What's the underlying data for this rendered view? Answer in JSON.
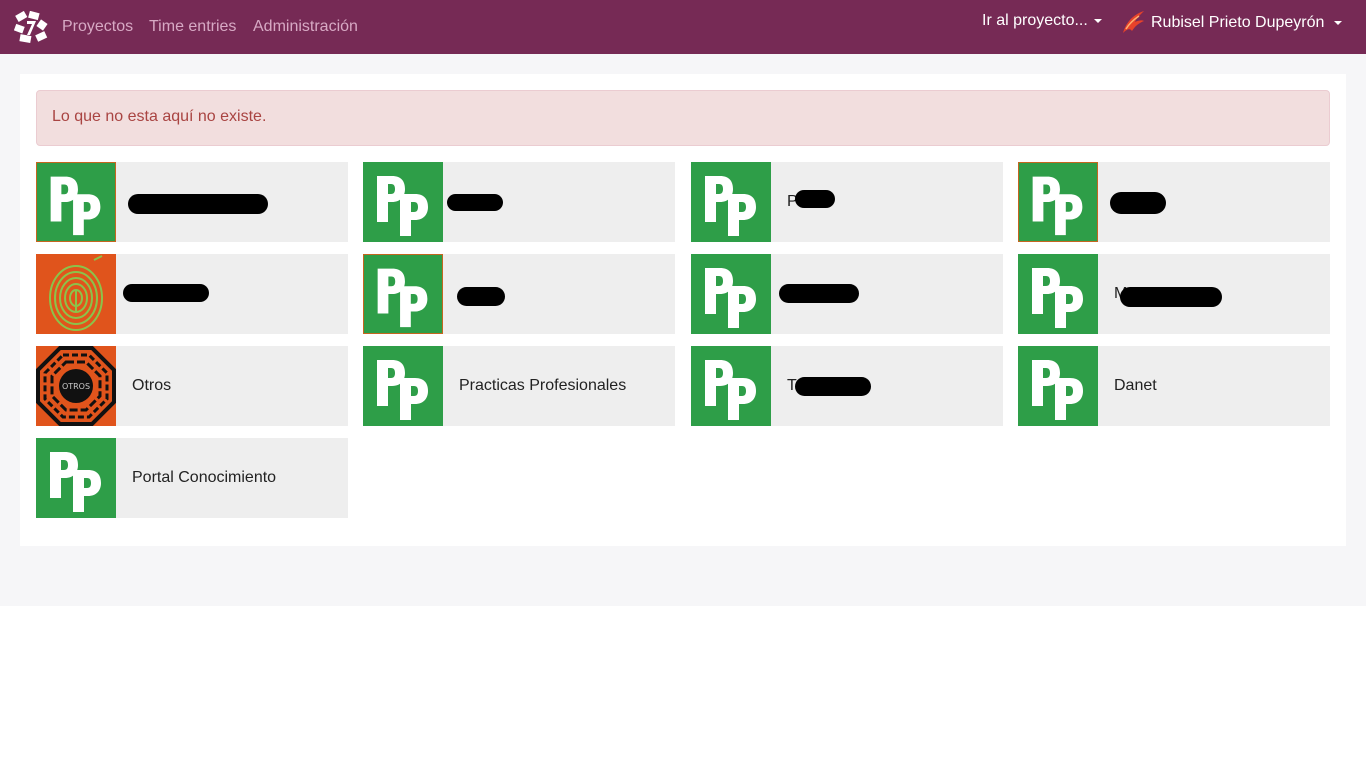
{
  "navbar": {
    "links": [
      "Proyectos",
      "Time entries",
      "Administración"
    ],
    "goto_project": "Ir al proyecto...",
    "user_name": "Rubisel Prieto Dupeyrón",
    "background_color": "#762a55"
  },
  "alert": {
    "message": "Lo que no esta aquí no existe."
  },
  "projects": [
    {
      "name": "",
      "logo": "pp-logo"
    },
    {
      "name": "",
      "logo": "pp-logo"
    },
    {
      "name": "P",
      "logo": "pp-logo"
    },
    {
      "name": "",
      "logo": "pp-logo"
    },
    {
      "name": "",
      "logo": "fingerprint-logo"
    },
    {
      "name": "",
      "logo": "pp-logo"
    },
    {
      "name": "",
      "logo": "pp-logo"
    },
    {
      "name": "M",
      "logo": "pp-logo"
    },
    {
      "name": "Otros",
      "logo": "otros-logo"
    },
    {
      "name": "Practicas Profesionales",
      "logo": "pp-logo"
    },
    {
      "name": "T",
      "logo": "pp-logo"
    },
    {
      "name": "Danet",
      "logo": "pp-logo"
    },
    {
      "name": "Portal Conocimiento",
      "logo": "pp-logo"
    }
  ],
  "otros_logo_text": "OTROS",
  "colors": {
    "pp_green": "#2e9e48",
    "fingerprint_orange": "#e0541c",
    "alert_text": "#a94442"
  }
}
